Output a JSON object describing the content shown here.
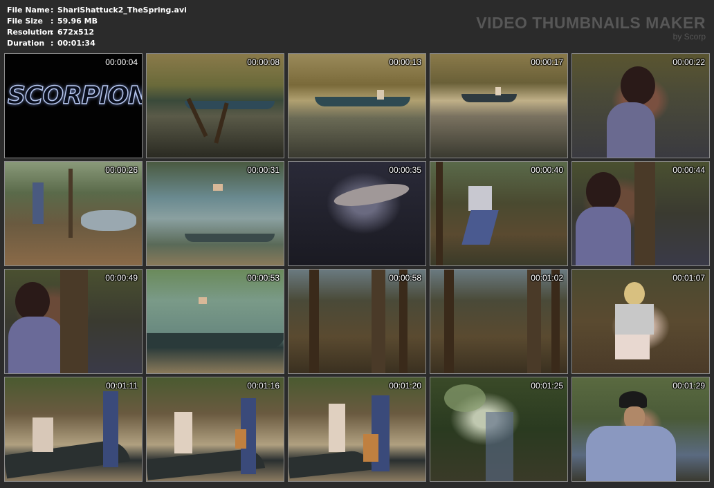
{
  "file_info": {
    "rows": [
      {
        "label": "File Name",
        "sep": ":",
        "value": "ShariShattuck2_TheSpring.avi"
      },
      {
        "label": "File Size",
        "sep": ":",
        "value": "59.96 MB"
      },
      {
        "label": "Resolution",
        "sep": ":",
        "value": "672x512"
      },
      {
        "label": "Duration",
        "sep": ":",
        "value": "00:01:34"
      }
    ]
  },
  "branding": {
    "title": "VIDEO THUMBNAILS MAKER",
    "subtitle": "by Scorp"
  },
  "thumbnails": [
    {
      "timestamp": "00:00:04",
      "overlay_text": "SCORPION"
    },
    {
      "timestamp": "00:00:08"
    },
    {
      "timestamp": "00:00:13"
    },
    {
      "timestamp": "00:00:17"
    },
    {
      "timestamp": "00:00:22"
    },
    {
      "timestamp": "00:00:26"
    },
    {
      "timestamp": "00:00:31"
    },
    {
      "timestamp": "00:00:35"
    },
    {
      "timestamp": "00:00:40"
    },
    {
      "timestamp": "00:00:44"
    },
    {
      "timestamp": "00:00:49"
    },
    {
      "timestamp": "00:00:53"
    },
    {
      "timestamp": "00:00:58"
    },
    {
      "timestamp": "00:01:02"
    },
    {
      "timestamp": "00:01:07"
    },
    {
      "timestamp": "00:01:11"
    },
    {
      "timestamp": "00:01:16"
    },
    {
      "timestamp": "00:01:20"
    },
    {
      "timestamp": "00:01:25"
    },
    {
      "timestamp": "00:01:29"
    }
  ],
  "colors": {
    "background": "#2b2b2b",
    "text": "#ffffff",
    "brand": "#575757",
    "thumb_border": "#8c8c8c"
  }
}
